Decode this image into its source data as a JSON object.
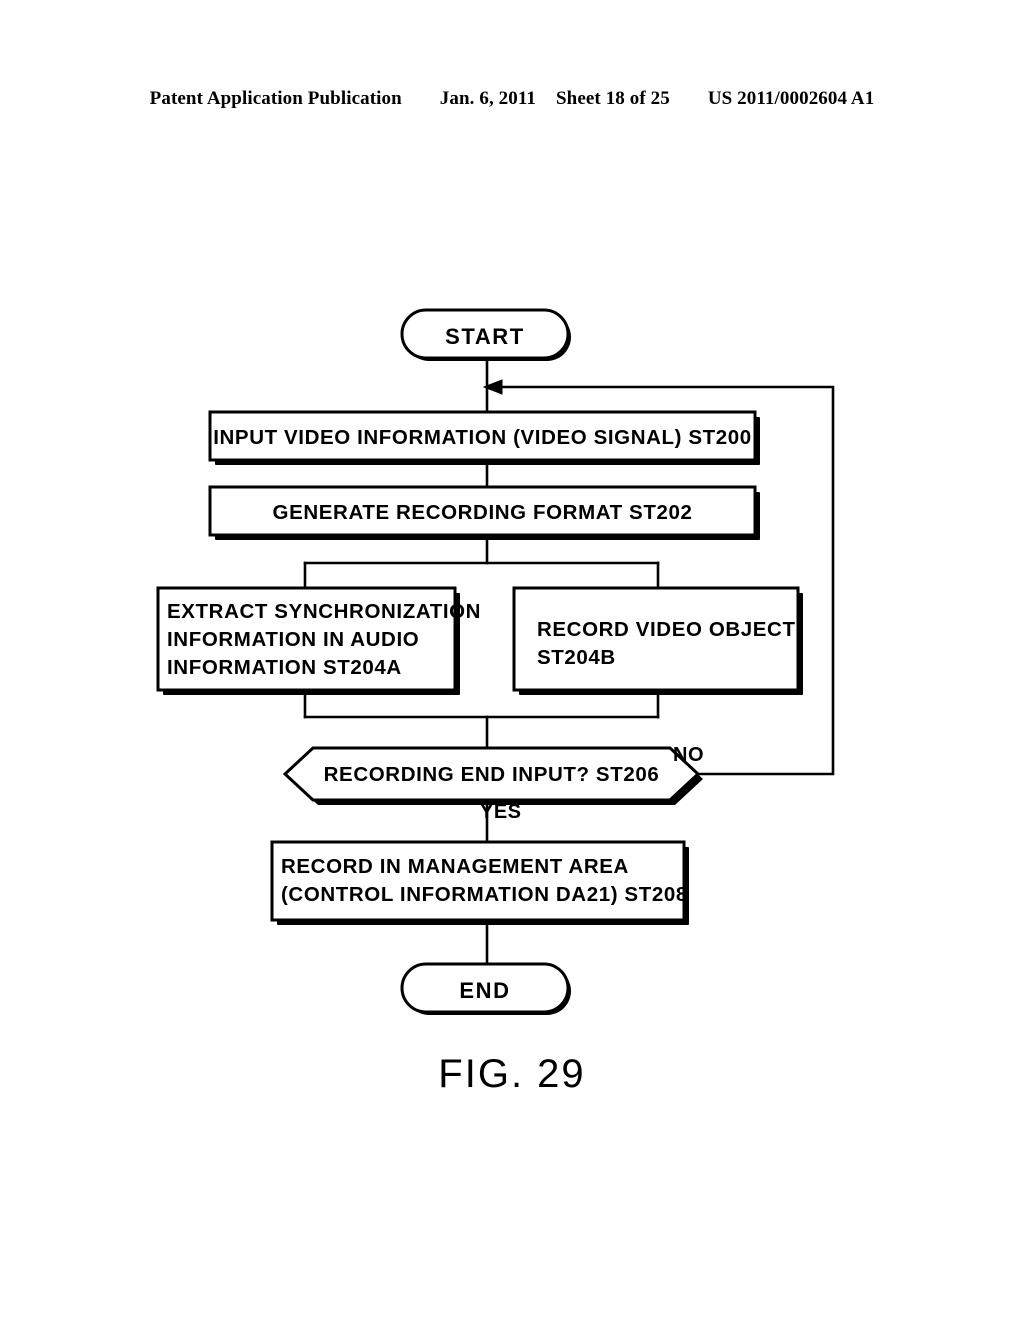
{
  "header": {
    "publication": "Patent Application Publication",
    "date": "Jan. 6, 2011",
    "sheet": "Sheet 18 of 25",
    "patent_number": "US 2011/0002604 A1"
  },
  "figure": {
    "caption": "FIG. 29"
  },
  "flowchart": {
    "start": {
      "label": "START"
    },
    "end": {
      "label": "END"
    },
    "steps": {
      "st200": {
        "line1": "INPUT VIDEO INFORMATION (VIDEO SIGNAL) ST200"
      },
      "st202": {
        "line1": "GENERATE RECORDING FORMAT ST202"
      },
      "st204a": {
        "line1": "EXTRACT SYNCHRONIZATION",
        "line2": "INFORMATION IN AUDIO",
        "line3": "INFORMATION ST204A"
      },
      "st204b": {
        "line1": "RECORD VIDEO OBJECT",
        "line2": "ST204B"
      },
      "st206": {
        "line1": "RECORDING END INPUT? ST206"
      },
      "st208": {
        "line1": "RECORD IN MANAGEMENT AREA",
        "line2": "(CONTROL INFORMATION DA21) ST208"
      }
    },
    "branches": {
      "no_label": "NO",
      "yes_label": "YES"
    },
    "colors": {
      "stroke": "#000000",
      "fill": "#ffffff",
      "shadow": "#000000"
    }
  }
}
